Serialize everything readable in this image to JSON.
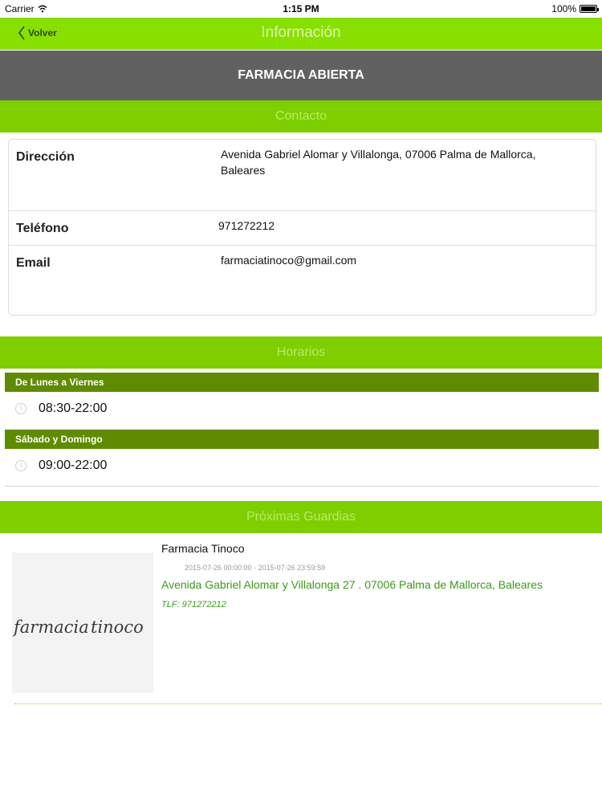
{
  "status_bar": {
    "carrier": "Carrier",
    "time": "1:15 PM",
    "battery": "100%",
    "wifi_icon": "wifi-icon",
    "battery_icon": "battery-icon"
  },
  "nav": {
    "back_label": "Volver",
    "title": "Información"
  },
  "banner": {
    "status": "FARMACIA ABIERTA"
  },
  "contact": {
    "header": "Contacto",
    "rows": [
      {
        "label": "Dirección",
        "value": "Avenida Gabriel Alomar y Villalonga, 07006 Palma de Mallorca, Baleares"
      },
      {
        "label": "Teléfono",
        "value": "971272212"
      },
      {
        "label": "Email",
        "value": "farmaciatinoco@gmail.com"
      }
    ]
  },
  "horarios": {
    "header": "Horarios",
    "groups": [
      {
        "day": "De Lunes a Viernes",
        "hours": "08:30-22:00"
      },
      {
        "day": "Sábado y Domingo",
        "hours": "09:00-22:00"
      }
    ]
  },
  "guardias": {
    "header": "Próximas Guardias",
    "items": [
      {
        "name": "Farmacia Tinoco",
        "dates": "2015-07-26 00:00:00 - 2015-07-26 23:59:59",
        "address": "Avenida Gabriel Alomar y Villalonga 27 . 07006 Palma de Mallorca, Baleares",
        "phone": "TLF: 971272212",
        "logo_text_a": "farmacia",
        "logo_text_b": "tinoco"
      }
    ]
  },
  "colors": {
    "nav_green": "#88e000",
    "section_green": "#7fce00",
    "schedule_green": "#5f8b00",
    "banner_gray": "#616161",
    "link_green": "#3d9a1a"
  }
}
